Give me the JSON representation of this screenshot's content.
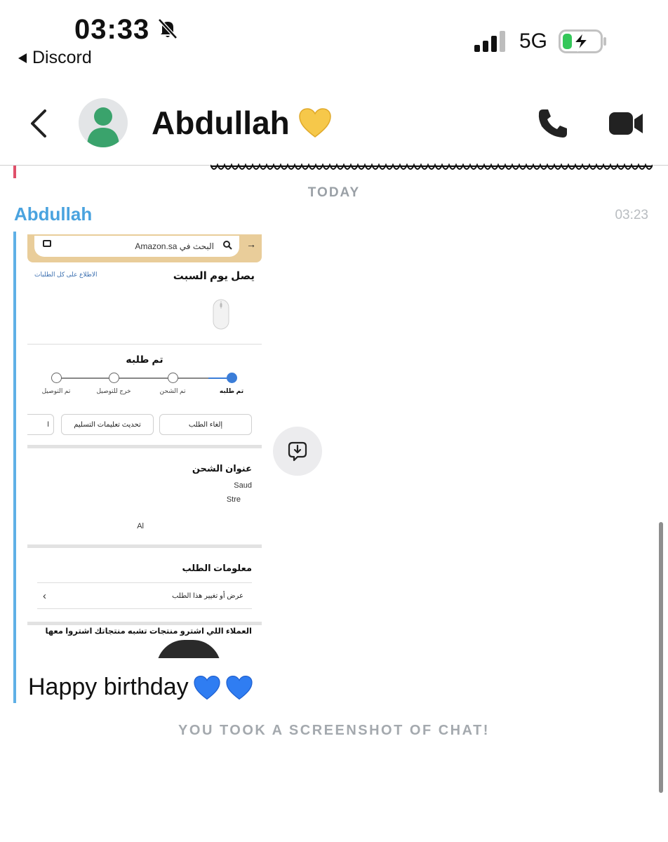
{
  "status_bar": {
    "time": "03:33",
    "back_app": "Discord",
    "network": "5G",
    "battery_color": "#34c759"
  },
  "header": {
    "contact_name": "Abdullah",
    "name_emoji": "yellow-heart-icon"
  },
  "chat": {
    "date_divider": "TODAY",
    "sender": "Abdullah",
    "sender_color": "#4aa3df",
    "timestamp": "03:23",
    "screenshot": {
      "search_placeholder": "البحث في Amazon.sa",
      "arrival": "يصل يوم السبت",
      "all_orders_link": "الاطلاع على كل الطلبات",
      "order_status": "تم طلبه",
      "steps": [
        "تم طلبه",
        "تم الشحن",
        "خرج للتوصيل",
        "تم التوصيل"
      ],
      "buttons": [
        "إلغاء الطلب",
        "تحديث تعليمات التسليم",
        "ا"
      ],
      "shipping_title": "عنوان الشحن",
      "address_lines": [
        "Saud",
        "Stre",
        "Al"
      ],
      "order_info_title": "معلومات الطلب",
      "order_info_row": "عرض أو تغيير هذا الطلب",
      "also_bought": "العملاء اللي اشترو منتجات تشبه منتجاتك اشتروا معها"
    },
    "message_text": "Happy birthday",
    "message_emojis": [
      "blue-heart-icon",
      "blue-heart-icon"
    ],
    "screenshot_notice": "YOU TOOK A SCREENSHOT OF CHAT!"
  }
}
